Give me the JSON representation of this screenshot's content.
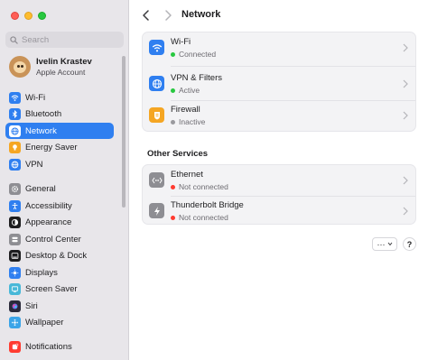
{
  "window": {
    "title": "Network"
  },
  "search": {
    "placeholder": "Search"
  },
  "account": {
    "name": "Ivelin Krastev",
    "subtitle": "Apple Account"
  },
  "sidebar": {
    "items": [
      {
        "label": "Wi-Fi",
        "icon": "wifi-icon",
        "color": "#2f7ff0",
        "active": false
      },
      {
        "label": "Bluetooth",
        "icon": "bluetooth-icon",
        "color": "#2f7ff0",
        "active": false
      },
      {
        "label": "Network",
        "icon": "globe-icon",
        "color": "#2f7ff0",
        "active": true
      },
      {
        "label": "Energy Saver",
        "icon": "bulb-icon",
        "color": "#f5a623",
        "active": false
      },
      {
        "label": "VPN",
        "icon": "vpn-globe-icon",
        "color": "#2f7ff0",
        "active": false
      },
      {
        "label": "General",
        "icon": "gear-icon",
        "color": "#8e8e93",
        "active": false
      },
      {
        "label": "Accessibility",
        "icon": "accessibility-icon",
        "color": "#2f7ff0",
        "active": false
      },
      {
        "label": "Appearance",
        "icon": "appearance-icon",
        "color": "#1d1d1f",
        "active": false
      },
      {
        "label": "Control Center",
        "icon": "control-center-icon",
        "color": "#8e8e93",
        "active": false
      },
      {
        "label": "Desktop & Dock",
        "icon": "dock-icon",
        "color": "#1d1d1f",
        "active": false
      },
      {
        "label": "Displays",
        "icon": "display-icon",
        "color": "#2f7ff0",
        "active": false
      },
      {
        "label": "Screen Saver",
        "icon": "screen-saver-icon",
        "color": "#48b8d8",
        "active": false
      },
      {
        "label": "Siri",
        "icon": "siri-icon",
        "color": "#2a2a3a",
        "active": false
      },
      {
        "label": "Wallpaper",
        "icon": "wallpaper-icon",
        "color": "#3aa4e8",
        "active": false
      },
      {
        "label": "Notifications",
        "icon": "bell-icon",
        "color": "#ff3b30",
        "active": false
      }
    ]
  },
  "main": {
    "services": [
      {
        "name": "Wi-Fi",
        "status": "Connected",
        "status_color": "#28c840",
        "icon": "wifi-icon",
        "icon_color": "#2f7ff0"
      },
      {
        "name": "VPN & Filters",
        "status": "Active",
        "status_color": "#28c840",
        "icon": "vpn-globe-icon",
        "icon_color": "#2f7ff0"
      },
      {
        "name": "Firewall",
        "status": "Inactive",
        "status_color": "#9a9a9e",
        "icon": "firewall-icon",
        "icon_color": "#f5a623"
      }
    ],
    "other_title": "Other Services",
    "other_services": [
      {
        "name": "Ethernet",
        "status": "Not connected",
        "status_color": "#ff3b30",
        "icon": "ethernet-icon",
        "icon_color": "#8e8e93"
      },
      {
        "name": "Thunderbolt Bridge",
        "status": "Not connected",
        "status_color": "#ff3b30",
        "icon": "thunderbolt-icon",
        "icon_color": "#8e8e93"
      }
    ],
    "more_label": "···",
    "help_label": "?"
  }
}
